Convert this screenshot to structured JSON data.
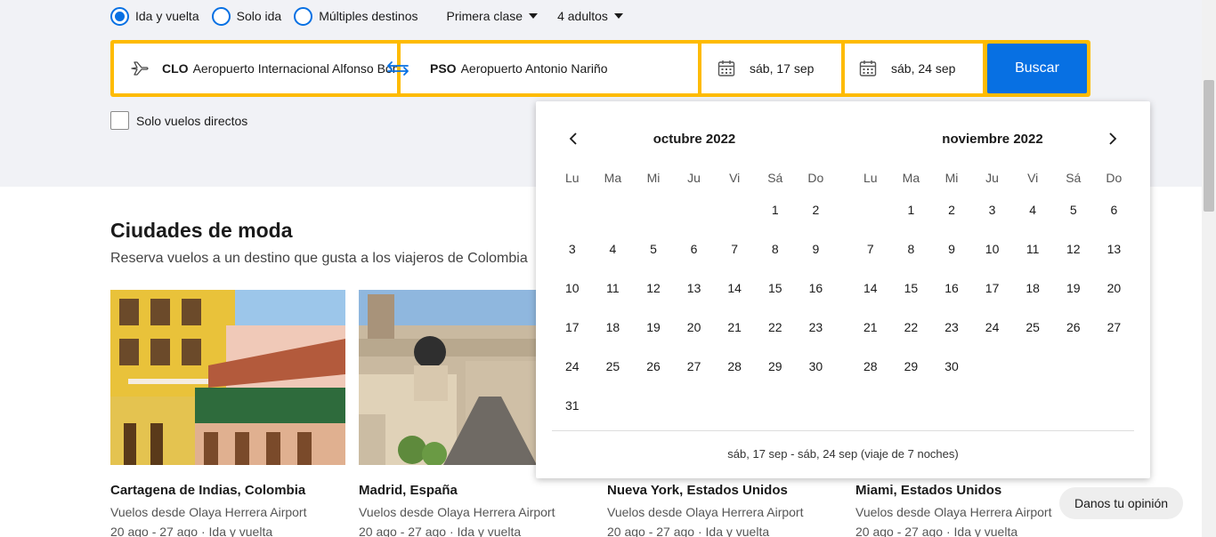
{
  "trip_options": {
    "roundtrip": "Ida y vuelta",
    "oneway": "Solo ida",
    "multi": "Múltiples destinos",
    "selected": "roundtrip",
    "cabin": "Primera clase",
    "travellers": "4 adultos"
  },
  "search": {
    "origin_code": "CLO",
    "origin_name": "Aeropuerto Internacional Alfonso Bonilla Aragón",
    "destination_code": "PSO",
    "destination_name": "Aeropuerto Antonio Nariño",
    "depart": "sáb, 17 sep",
    "return": "sáb, 24 sep",
    "button": "Buscar"
  },
  "direct_only": "Solo vuelos directos",
  "trending": {
    "title": "Ciudades de moda",
    "subtitle": "Reserva vuelos a un destino que gusta a los viajeros de Colombia",
    "cards": [
      {
        "city": "Cartagena de Indias, Colombia",
        "from": "Vuelos desde Olaya Herrera Airport",
        "dates": "20 ago - 27 ago · Ida y vuelta"
      },
      {
        "city": "Madrid, España",
        "from": "Vuelos desde Olaya Herrera Airport",
        "dates": "20 ago - 27 ago · Ida y vuelta"
      },
      {
        "city": "Nueva York, Estados Unidos",
        "from": "Vuelos desde Olaya Herrera Airport",
        "dates": "20 ago - 27 ago · Ida y vuelta"
      },
      {
        "city": "Miami, Estados Unidos",
        "from": "Vuelos desde Olaya Herrera Airport",
        "dates": "20 ago - 27 ago · Ida y vuelta"
      }
    ]
  },
  "calendar": {
    "weekdays": [
      "Lu",
      "Ma",
      "Mi",
      "Ju",
      "Vi",
      "Sá",
      "Do"
    ],
    "months": [
      {
        "title": "octubre 2022",
        "first_weekday": 5,
        "days": 31
      },
      {
        "title": "noviembre 2022",
        "first_weekday": 1,
        "days": 30
      }
    ],
    "range_text": "sáb, 17 sep - sáb, 24 sep (viaje de 7 noches)"
  },
  "feedback": "Danos tu opinión",
  "colors": {
    "accent": "#0770e3",
    "search_border": "#febb02",
    "top_bg": "#f1f2f6"
  }
}
